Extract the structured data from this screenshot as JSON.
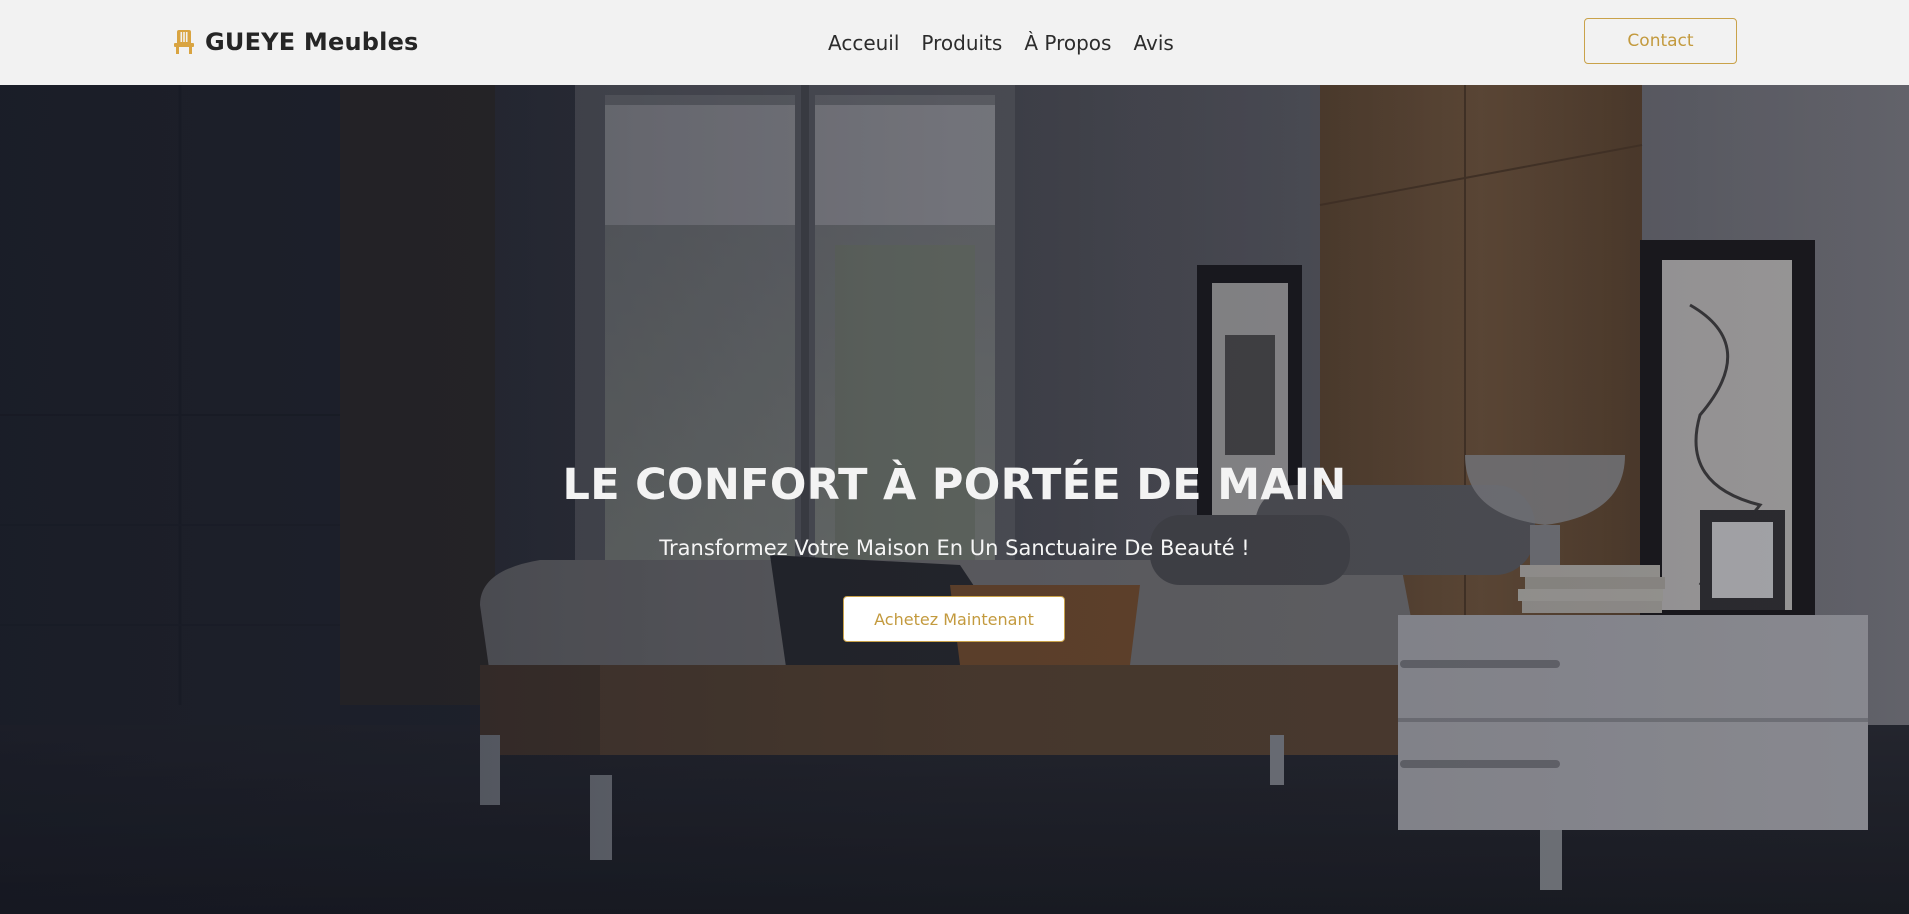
{
  "navbar": {
    "brand": {
      "name": "GUEYE Meubles",
      "icon": "chair-icon",
      "icon_color": "#d9a441"
    },
    "links": [
      {
        "label": "Acceuil"
      },
      {
        "label": "Produits"
      },
      {
        "label": "À Propos"
      },
      {
        "label": "Avis"
      }
    ],
    "contact_label": "Contact"
  },
  "hero": {
    "title": "LE CONFORT À PORTÉE DE MAIN",
    "subtitle": "Transformez Votre Maison En Un Sanctuaire De Beauté !",
    "cta_label": "Achetez Maintenant",
    "background": "bedroom-photo"
  },
  "colors": {
    "accent": "#c9a24a",
    "navbar_bg": "#f2f2f2",
    "text_dark": "#252525"
  }
}
